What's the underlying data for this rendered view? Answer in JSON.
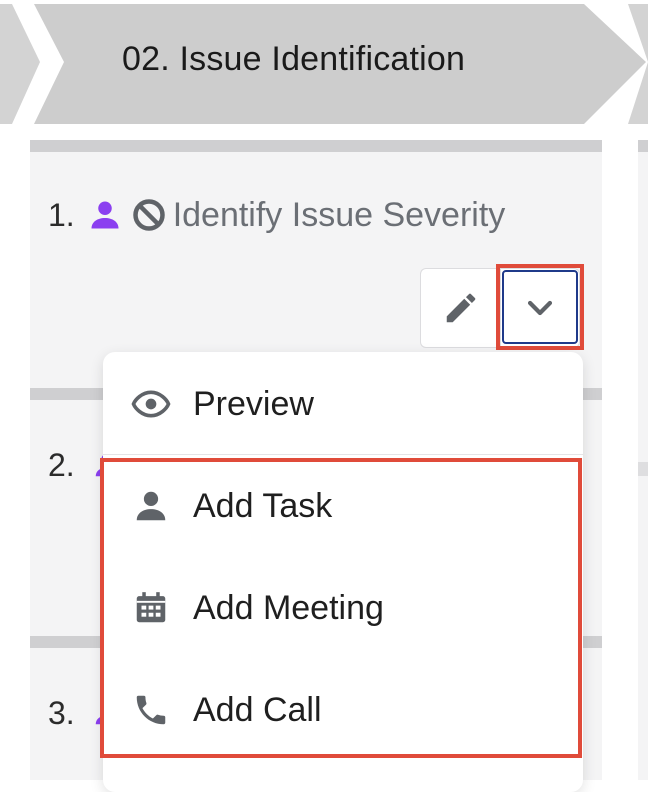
{
  "stage": {
    "title": "02. Issue Identification"
  },
  "tasks": [
    {
      "number": "1.",
      "title": "Identify Issue Severity"
    },
    {
      "number": "2."
    },
    {
      "number": "3."
    }
  ],
  "actions": {
    "edit_icon": "pencil-icon",
    "dropdown_icon": "chevron-down-icon"
  },
  "menu": {
    "items": [
      {
        "label": "Preview",
        "icon": "eye-icon"
      },
      {
        "label": "Add Task",
        "icon": "person-icon"
      },
      {
        "label": "Add Meeting",
        "icon": "calendar-icon"
      },
      {
        "label": "Add Call",
        "icon": "phone-icon"
      }
    ]
  },
  "colors": {
    "chevron": "#d0d0d0",
    "highlight": "#e04b3a",
    "assignee_icon": "#8b3ff0",
    "icon_gray": "#5f6368",
    "focus_ring": "#1f3a8a"
  }
}
